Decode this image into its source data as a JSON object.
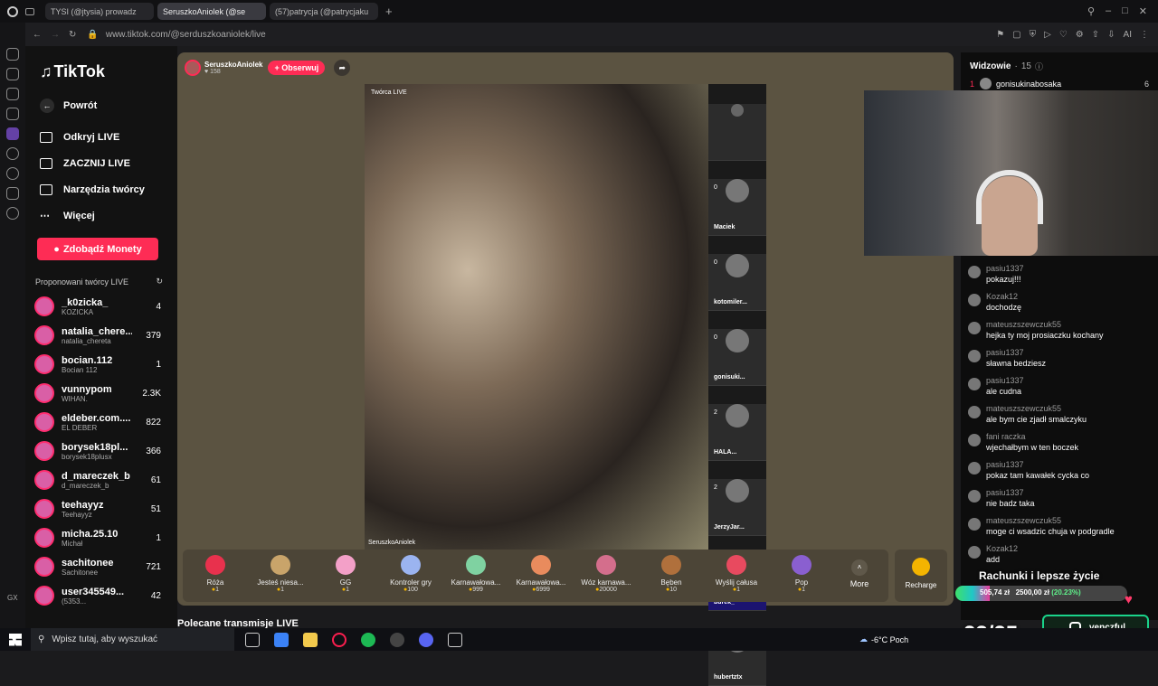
{
  "browser": {
    "tabs": [
      {
        "label": "TYSI (@jtysia) prowadz"
      },
      {
        "label": "SeruszkoAniolek (@se"
      },
      {
        "label": "(57)patrycja (@patrycjaku"
      }
    ],
    "url": "www.tiktok.com/@serduszkoaniolek/live"
  },
  "sidebar": {
    "logo": "TikTok",
    "back": "Powrót",
    "nav": [
      {
        "label": "Odkryj LIVE"
      },
      {
        "label": "ZACZNIJ LIVE"
      },
      {
        "label": "Narzędzia twórcy"
      },
      {
        "label": "Więcej"
      }
    ],
    "coins_button": "Zdobądź Monety",
    "suggested_title": "Proponowani twórcy LIVE",
    "creators": [
      {
        "name": "_k0zicka_",
        "sub": "KOZICKA",
        "count": "4"
      },
      {
        "name": "natalia_chere...",
        "sub": "natalia_chereta",
        "count": "379"
      },
      {
        "name": "bocian.112",
        "sub": "Bocian 112",
        "count": "1"
      },
      {
        "name": "vunnypom",
        "sub": "WIHAN.",
        "count": "2.3K"
      },
      {
        "name": "eldeber.com....",
        "sub": "EL DEBER",
        "count": "822"
      },
      {
        "name": "borysek18pl...",
        "sub": "borysek18plusx",
        "count": "366"
      },
      {
        "name": "d_mareczek_b",
        "sub": "d_mareczek_b",
        "count": "61"
      },
      {
        "name": "teehayyz",
        "sub": "Teehayyz",
        "count": "51"
      },
      {
        "name": "micha.25.10",
        "sub": "Michał",
        "count": "1"
      },
      {
        "name": "sachitonee",
        "sub": "Sachitonee",
        "count": "721"
      },
      {
        "name": "user345549...",
        "sub": "(5353...",
        "count": "42"
      }
    ]
  },
  "stream": {
    "host": "SeruszkoAniolek",
    "likes": "158",
    "follow": "+ Obserwuj",
    "creator_label": "Twórca LIVE",
    "watermark": "SeruszkoAniolek",
    "guests": [
      {
        "count": "",
        "name": ""
      },
      {
        "count": "0",
        "name": "Maciek"
      },
      {
        "count": "0",
        "name": "kotomiler..."
      },
      {
        "count": "0",
        "name": "gonisuki..."
      },
      {
        "count": "2",
        "name": "HALA..."
      },
      {
        "count": "2",
        "name": "JerzyJar..."
      },
      {
        "count": "2",
        "name": "burek_"
      },
      {
        "count": "0",
        "name": "hubertztx"
      }
    ]
  },
  "gifts": [
    {
      "name": "Róża",
      "price": "1",
      "color": "#e8314d"
    },
    {
      "name": "Jesteś niesa...",
      "price": "1",
      "color": "#c9a46a"
    },
    {
      "name": "GG",
      "price": "1",
      "color": "#f3a0c8"
    },
    {
      "name": "Kontroler gry",
      "price": "100",
      "color": "#9bb4f0"
    },
    {
      "name": "Karnawałowa...",
      "price": "999",
      "color": "#7fd2a1"
    },
    {
      "name": "Karnawałowa...",
      "price": "6999",
      "color": "#e98b5d"
    },
    {
      "name": "Wóz karnawa...",
      "price": "20000",
      "color": "#d46e8c"
    },
    {
      "name": "Bęben",
      "price": "10",
      "color": "#b0703c"
    },
    {
      "name": "Wyślij całusa",
      "price": "1",
      "color": "#e84a5f"
    },
    {
      "name": "Pop",
      "price": "1",
      "color": "#8a5fd0"
    }
  ],
  "more": "More",
  "recharge": "Recharge",
  "recommended": "Polecane transmisje LIVE",
  "viewers": {
    "title": "Widzowie",
    "count": "15",
    "top_name": "gonisukinabosaka",
    "top_rank": "1",
    "top_score": "6"
  },
  "chat": [
    {
      "user": "pasiu1337",
      "text": "pokazuj!!!"
    },
    {
      "user": "Kozak12",
      "text": "dochodzę"
    },
    {
      "user": "mateuszszewczuk55",
      "text": "hejka ty moj prosiaczku kochany"
    },
    {
      "user": "pasiu1337",
      "text": "sławna bedziesz"
    },
    {
      "user": "pasiu1337",
      "text": "ale cudna"
    },
    {
      "user": "mateuszszewczuk55",
      "text": "ale bym cie zjadł smalczyku"
    },
    {
      "user": "fani raczka",
      "text": "wjechałbym w ten boczek"
    },
    {
      "user": "pasiu1337",
      "text": "pokaz tam kawałek cycka co"
    },
    {
      "user": "pasiu1337",
      "text": "nie badz taka"
    },
    {
      "user": "mateuszszewczuk55",
      "text": "moge ci wsadzic chuja w podgradle"
    },
    {
      "user": "Kozak12",
      "text": "add"
    }
  ],
  "overlay": {
    "goal_title": "Rachunki i lepsze życie",
    "goal_current": "505,74 zł",
    "goal_target": "2500,00 zł",
    "goal_percent": "(20.23%)",
    "progress": 0.2023,
    "counter": "23/25",
    "social": "venczful"
  },
  "taskbar": {
    "search": "Wpisz tutaj, aby wyszukać",
    "weather": "-6°C",
    "weather_desc": "Poch"
  }
}
